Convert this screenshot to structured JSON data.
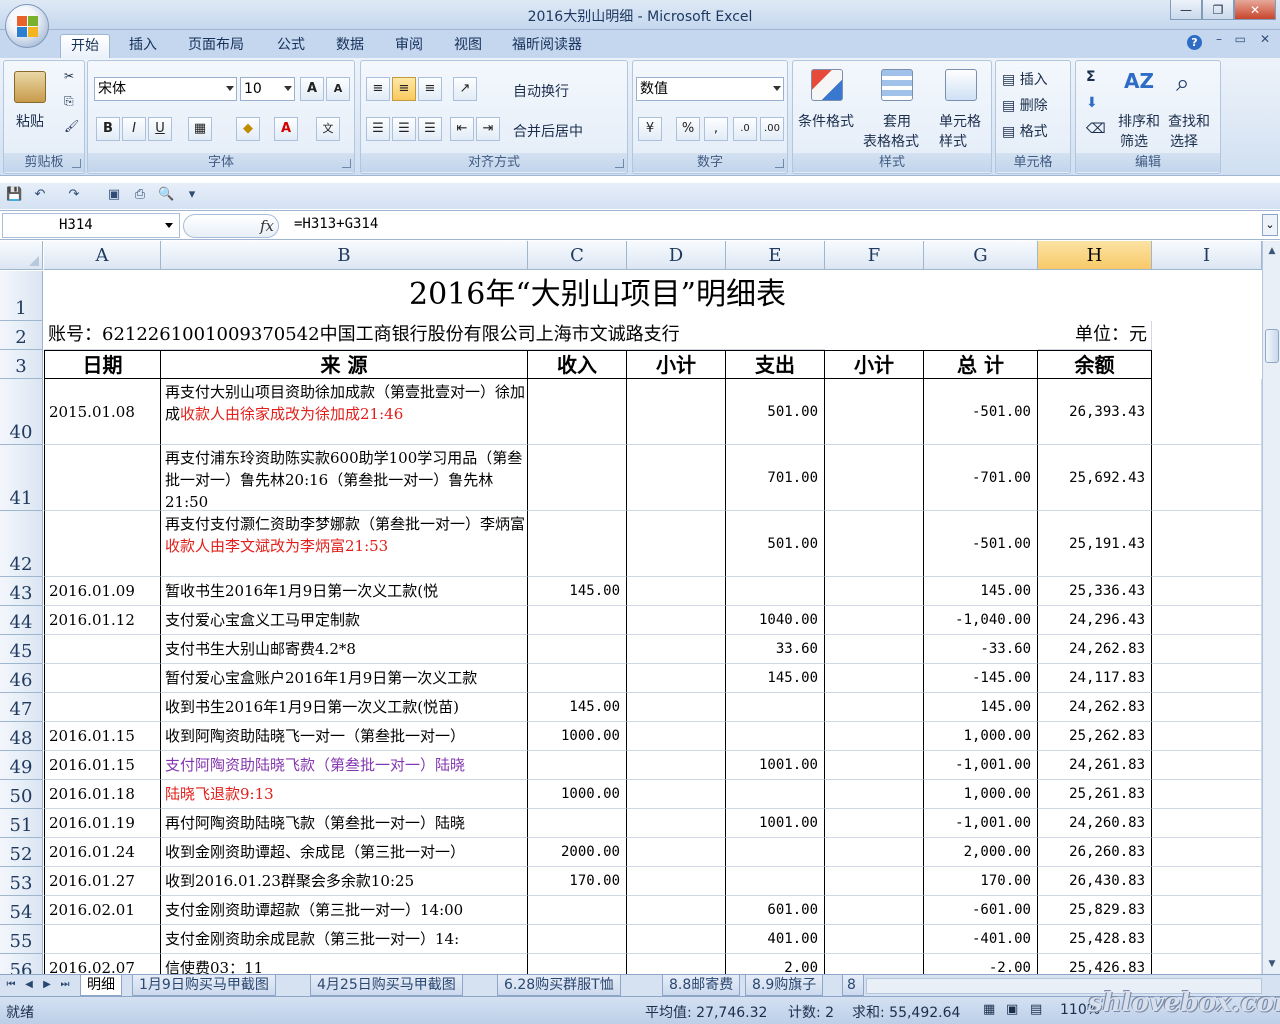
{
  "window": {
    "title": "2016大别山明细 - Microsoft Excel"
  },
  "tabs": [
    "开始",
    "插入",
    "页面布局",
    "公式",
    "数据",
    "审阅",
    "视图",
    "福昕阅读器"
  ],
  "ribbon": {
    "clipboard": {
      "paste": "粘贴",
      "group": "剪贴板"
    },
    "font": {
      "name": "宋体",
      "size": "10",
      "group": "字体"
    },
    "alignment": {
      "wrap": "自动换行",
      "merge": "合并后居中",
      "group": "对齐方式"
    },
    "number": {
      "format": "数值",
      "group": "数字"
    },
    "styles": {
      "conditional": "条件格式",
      "table1": "套用",
      "table2": "表格格式",
      "cell1": "单元格",
      "cell2": "样式",
      "group": "样式"
    },
    "cells": {
      "insert": "插入",
      "delete": "删除",
      "format": "格式",
      "group": "单元格"
    },
    "editing": {
      "sort1": "排序和",
      "sort2": "筛选",
      "find1": "查找和",
      "find2": "选择",
      "group": "编辑"
    }
  },
  "formula_bar": {
    "name_box": "H314",
    "fx": "fx",
    "formula": "=H313+G314"
  },
  "columns": [
    "A",
    "B",
    "C",
    "D",
    "E",
    "F",
    "G",
    "H",
    "I"
  ],
  "sheet": {
    "title": "2016年“大别山项目”明细表",
    "account": "账号：6212261001009370542中国工商银行股份有限公司上海市文诚路支行",
    "unit": "单位：元",
    "headers": [
      "日期",
      "来 源",
      "收入",
      "小计",
      "支出",
      "小计",
      "总 计",
      "余额"
    ],
    "rows": [
      {
        "n": "40",
        "a": "2015.01.08",
        "b1": "再支付大别山项目资助徐加成款（第壹批壹对一）徐加成",
        "b2": "收款人由徐家成改为徐加成21:46",
        "c": "",
        "e": "501.00",
        "g": "-501.00",
        "h": "26,393.43"
      },
      {
        "n": "41",
        "a": "",
        "b1": "再支付浦东玲资助陈实款600助学100学习用品（第叁批一对一）鲁先林20:16（第叁批一对一）鲁先林21:50",
        "b2": "",
        "c": "",
        "e": "701.00",
        "g": "-701.00",
        "h": "25,692.43"
      },
      {
        "n": "42",
        "a": "",
        "b1": "再支付支付灏仁资助李梦娜款（第叁批一对一）李炳富",
        "b2": "收款人由李文斌改为李炳富21:53",
        "c": "",
        "e": "501.00",
        "g": "-501.00",
        "h": "25,191.43"
      },
      {
        "n": "43",
        "a": "2016.01.09",
        "b1": "暂收书生2016年1月9日第一次义工款(悦",
        "b2": "",
        "c": "145.00",
        "e": "",
        "g": "145.00",
        "h": "25,336.43"
      },
      {
        "n": "44",
        "a": "2016.01.12",
        "b1": "支付爱心宝盒义工马甲定制款",
        "b2": "",
        "c": "",
        "e": "1040.00",
        "g": "-1,040.00",
        "h": "24,296.43"
      },
      {
        "n": "45",
        "a": "",
        "b1": "支付书生大别山邮寄费4.2*8",
        "b2": "",
        "c": "",
        "e": "33.60",
        "g": "-33.60",
        "h": "24,262.83"
      },
      {
        "n": "46",
        "a": "",
        "b1": "暂付爱心宝盒账户2016年1月9日第一次义工款",
        "b2": "",
        "c": "",
        "e": "145.00",
        "g": "-145.00",
        "h": "24,117.83"
      },
      {
        "n": "47",
        "a": "",
        "b1": "收到书生2016年1月9日第一次义工款(悦苗)",
        "b2": "",
        "c": "145.00",
        "e": "",
        "g": "145.00",
        "h": "24,262.83"
      },
      {
        "n": "48",
        "a": "2016.01.15",
        "b1": "收到阿陶资助陆晓飞一对一（第叁批一对一）",
        "b2": "",
        "c": "1000.00",
        "e": "",
        "g": "1,000.00",
        "h": "25,262.83"
      },
      {
        "n": "49",
        "a": "2016.01.15",
        "b1": "支付阿陶资助陆晓飞款（第叁批一对一）陆晓",
        "b2": "",
        "c": "",
        "e": "1001.00",
        "g": "-1,001.00",
        "h": "24,261.83"
      },
      {
        "n": "50",
        "a": "2016.01.18",
        "b1": "陆晓飞退款9:13",
        "b2": "",
        "c": "1000.00",
        "e": "",
        "g": "1,000.00",
        "h": "25,261.83"
      },
      {
        "n": "51",
        "a": "2016.01.19",
        "b1": "再付阿陶资助陆晓飞款（第叁批一对一）陆晓",
        "b2": "",
        "c": "",
        "e": "1001.00",
        "g": "-1,001.00",
        "h": "24,260.83"
      },
      {
        "n": "52",
        "a": "2016.01.24",
        "b1": "收到金刚资助谭超、余成昆（第三批一对一）",
        "b2": "",
        "c": "2000.00",
        "e": "",
        "g": "2,000.00",
        "h": "26,260.83"
      },
      {
        "n": "53",
        "a": "2016.01.27",
        "b1": "收到2016.01.23群聚会多余款10:25",
        "b2": "",
        "c": "170.00",
        "e": "",
        "g": "170.00",
        "h": "26,430.83"
      },
      {
        "n": "54",
        "a": "2016.02.01",
        "b1": "支付金刚资助谭超款（第三批一对一）14:00",
        "b2": "",
        "c": "",
        "e": "601.00",
        "g": "-601.00",
        "h": "25,829.83"
      },
      {
        "n": "55",
        "a": "",
        "b1": "支付金刚资助余成昆款（第三批一对一）14:",
        "b2": "",
        "c": "",
        "e": "401.00",
        "g": "-401.00",
        "h": "25,428.83"
      },
      {
        "n": "56",
        "a": "2016.02.07",
        "b1": "信使费03：11",
        "b2": "",
        "c": "",
        "e": "2.00",
        "g": "-2.00",
        "h": "25,426.83"
      }
    ]
  },
  "sheet_tabs": [
    "明细",
    "1月9日购买马甲截图",
    "4月25日购买马甲截图",
    "6.28购买群服T恤",
    "8.8邮寄费",
    "8.9购旗子",
    "8"
  ],
  "status": {
    "ready": "就绪",
    "average": "平均值: 27,746.32",
    "count": "计数: 2",
    "sum": "求和: 55,492.64",
    "zoom": "110%"
  },
  "watermark": "shlovebox.com",
  "colors": {
    "red_text": "#e1201b",
    "purple_text": "#8437b1",
    "selected_header": "#f8c969"
  }
}
